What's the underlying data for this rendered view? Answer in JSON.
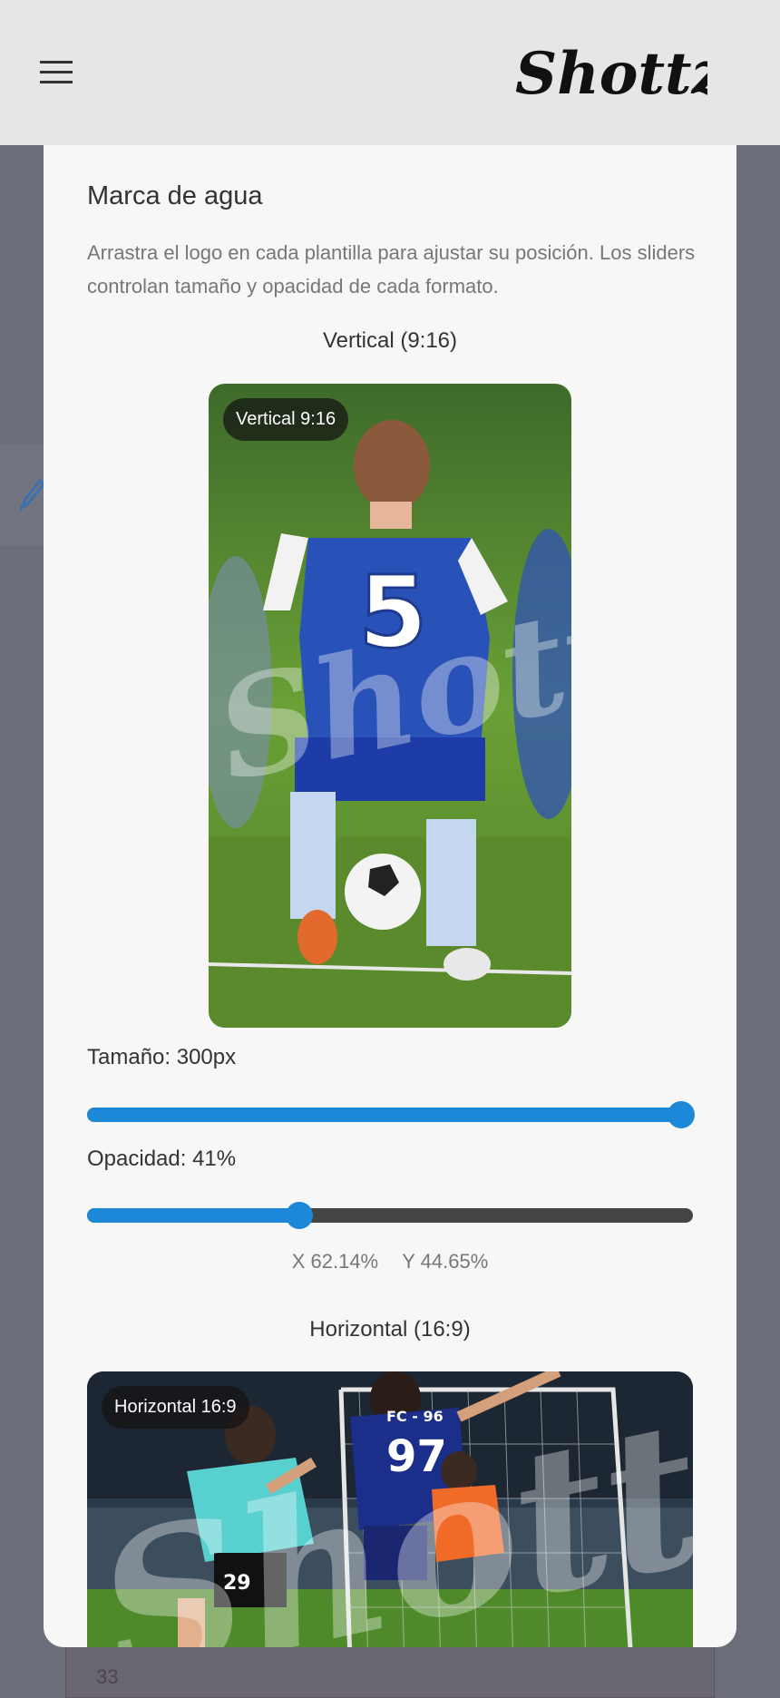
{
  "header": {
    "brand": "Shottz",
    "menu_icon": "hamburger-menu-icon"
  },
  "background": {
    "number": "33",
    "icon": "pencil-icon"
  },
  "modal": {
    "title": "Marca de agua",
    "description": "Arrastra el logo en cada plantilla para ajustar su posición. Los sliders controlan tamaño y opacidad de cada formato.",
    "vertical": {
      "section_label": "Vertical (9:16)",
      "badge": "Vertical 9:16",
      "size_label": "Tamaño: 300px",
      "size_fraction": 0.98,
      "opacity_label": "Opacidad: 41%",
      "opacity_fraction": 0.35,
      "coord_x": "X 62.14%",
      "coord_y": "Y 44.65%"
    },
    "horizontal": {
      "section_label": "Horizontal (16:9)",
      "badge": "Horizontal 16:9"
    },
    "colors": {
      "accent": "#1e88d8",
      "track": "#444444"
    }
  }
}
